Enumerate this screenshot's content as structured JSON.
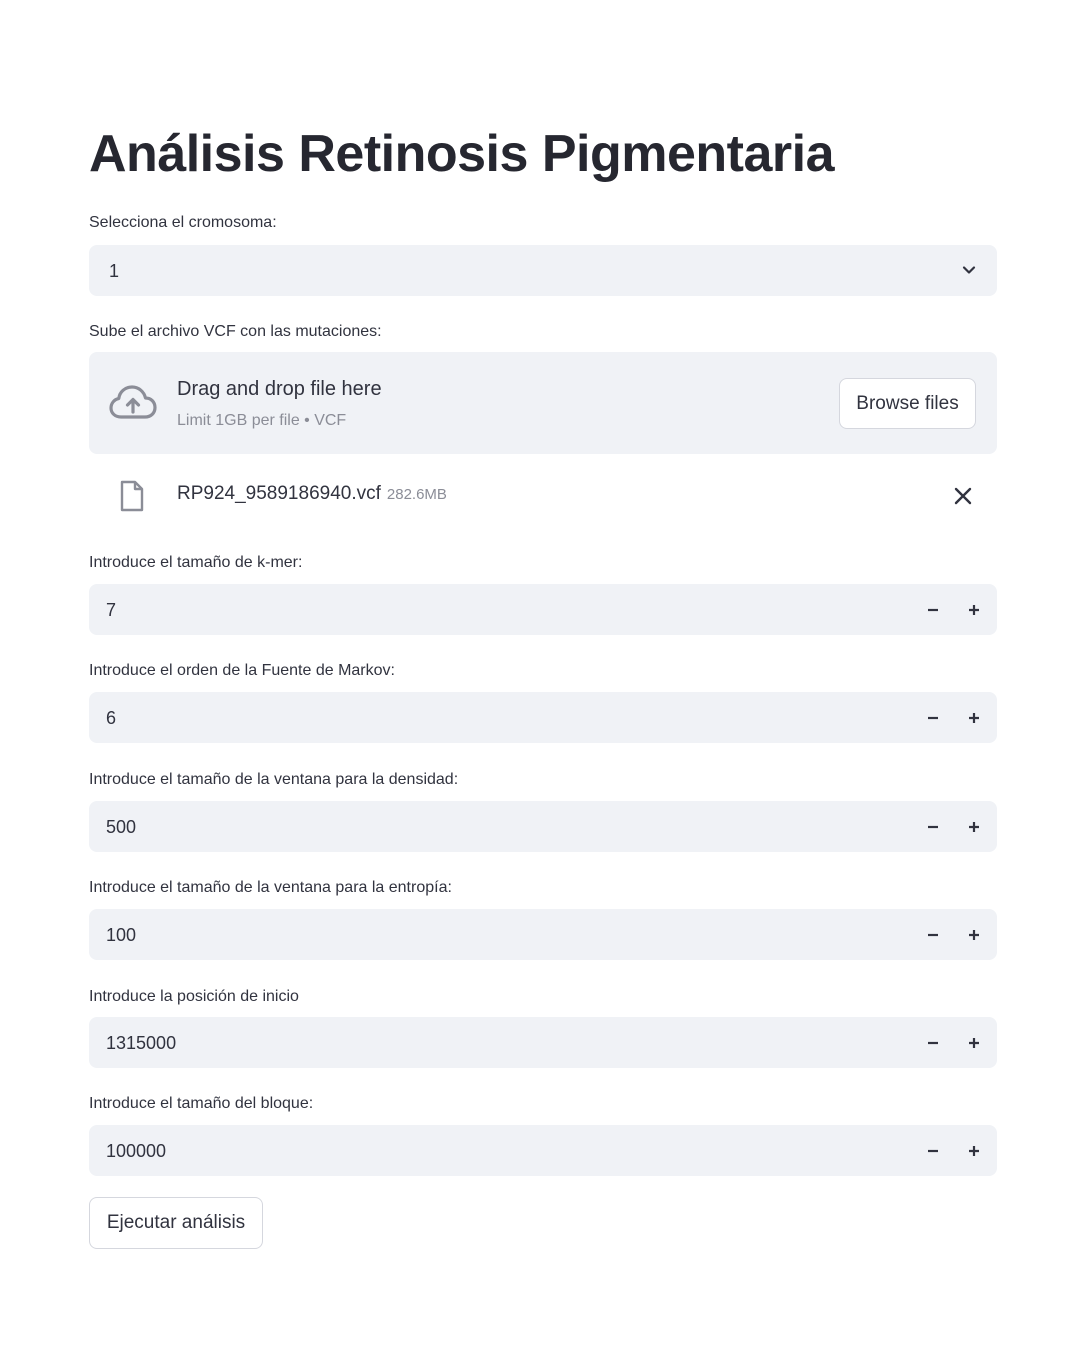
{
  "title": "Análisis Retinosis Pigmentaria",
  "chromosome": {
    "label": "Selecciona el cromosoma:",
    "value": "1",
    "icon": "chevron-down-icon"
  },
  "upload": {
    "label": "Sube el archivo VCF con las mutaciones:",
    "drop_text": "Drag and drop file here",
    "limit_text": "Limit 1GB per file • VCF",
    "browse_label": "Browse files",
    "icon": "cloud-upload-icon",
    "file": {
      "name": "RP924_9589186940.vcf",
      "size": "282.6MB",
      "icon": "file-icon"
    }
  },
  "inputs": [
    {
      "label": "Introduce el tamaño de k-mer:",
      "value": "7"
    },
    {
      "label": "Introduce el orden de la Fuente de Markov:",
      "value": "6"
    },
    {
      "label": "Introduce el tamaño de la ventana para la densidad:",
      "value": "500"
    },
    {
      "label": "Introduce el tamaño de la ventana para la entropía:",
      "value": "100"
    },
    {
      "label": "Introduce la posición de inicio",
      "value": "1315000"
    },
    {
      "label": "Introduce el tamaño del bloque:",
      "value": "100000"
    }
  ],
  "run_button": "Ejecutar análisis",
  "colors": {
    "field_bg": "#f0f2f6",
    "text": "#31333f",
    "muted": "#8b8d97"
  }
}
